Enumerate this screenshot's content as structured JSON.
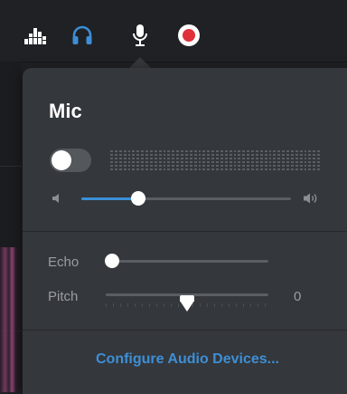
{
  "toolbar": {
    "icons": [
      "equalizer-icon",
      "headphones-icon",
      "microphone-icon",
      "record-icon"
    ],
    "colors": {
      "active": "#3d8fd6",
      "record": "#e0303a",
      "icon": "#ffffff"
    }
  },
  "popover": {
    "title": "Mic",
    "mic_toggle_on": false,
    "volume_level": 0.27,
    "volume_low_icon": "speaker-low-icon",
    "volume_high_icon": "speaker-high-icon",
    "echo": {
      "label": "Echo",
      "level": 0.0
    },
    "pitch": {
      "label": "Pitch",
      "value": "0",
      "level": 0.5
    },
    "configure_label": "Configure Audio Devices..."
  }
}
